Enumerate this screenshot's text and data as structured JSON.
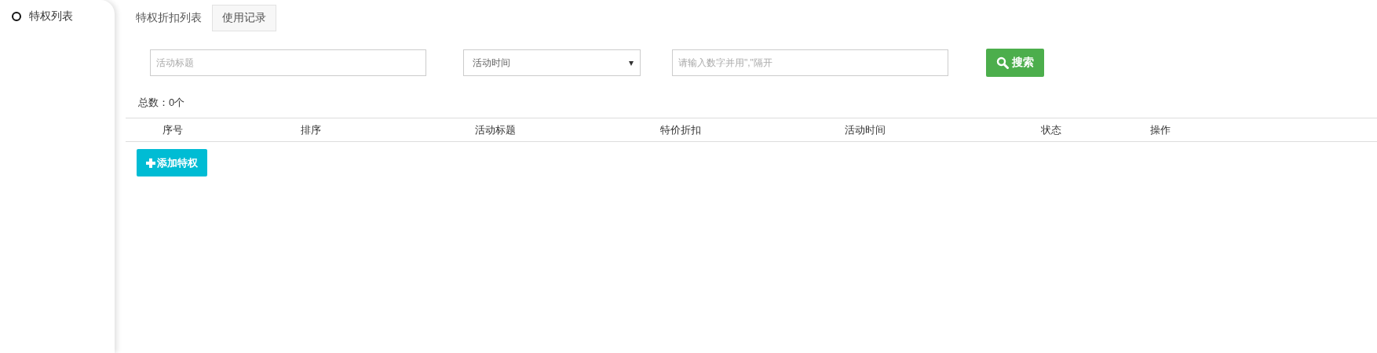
{
  "sidebar": {
    "items": [
      {
        "label": "特权列表"
      }
    ]
  },
  "tabs": [
    {
      "label": "特权折扣列表",
      "selected": true
    },
    {
      "label": "使用记录",
      "selected": false
    }
  ],
  "filters": {
    "title": {
      "placeholder": "活动标题"
    },
    "time": {
      "value": "活动时间",
      "caret": "▾"
    },
    "ids": {
      "placeholder": "请输入数字并用\",\"隔开"
    },
    "search_button": "搜索"
  },
  "total": {
    "label": "总数：",
    "value": "0个"
  },
  "table": {
    "columns": [
      "序号",
      "排序",
      "活动标题",
      "特价折扣",
      "活动时间",
      "状态",
      "操作"
    ]
  },
  "add_button": "添加特权"
}
